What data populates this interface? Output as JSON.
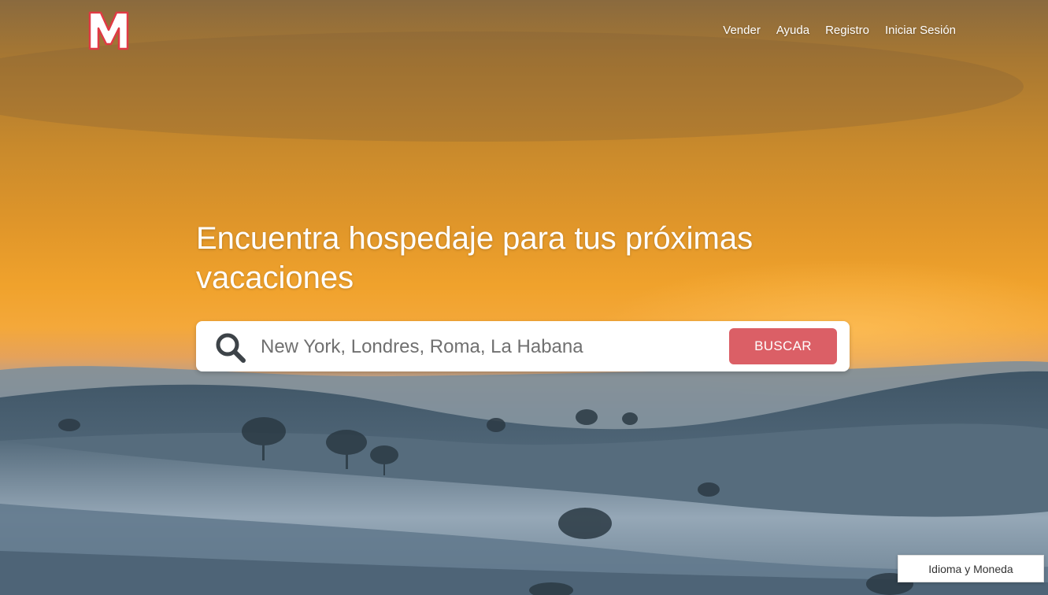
{
  "brand": {
    "logo_letter": "M",
    "logo_color": "#e03a44"
  },
  "nav": {
    "items": [
      {
        "label": "Vender"
      },
      {
        "label": "Ayuda"
      },
      {
        "label": "Registro"
      },
      {
        "label": "Iniciar Sesión"
      }
    ]
  },
  "hero": {
    "headline": "Encuentra hospedaje para tus próximas vacaciones",
    "search": {
      "placeholder": "New York, Londres, Roma, La Habana",
      "value": "",
      "button_label": "BUSCAR",
      "icon": "search-icon"
    }
  },
  "footer": {
    "language_currency_label": "Idioma y Moneda"
  },
  "colors": {
    "accent": "#db5f66",
    "text_on_hero": "#ffffff"
  }
}
